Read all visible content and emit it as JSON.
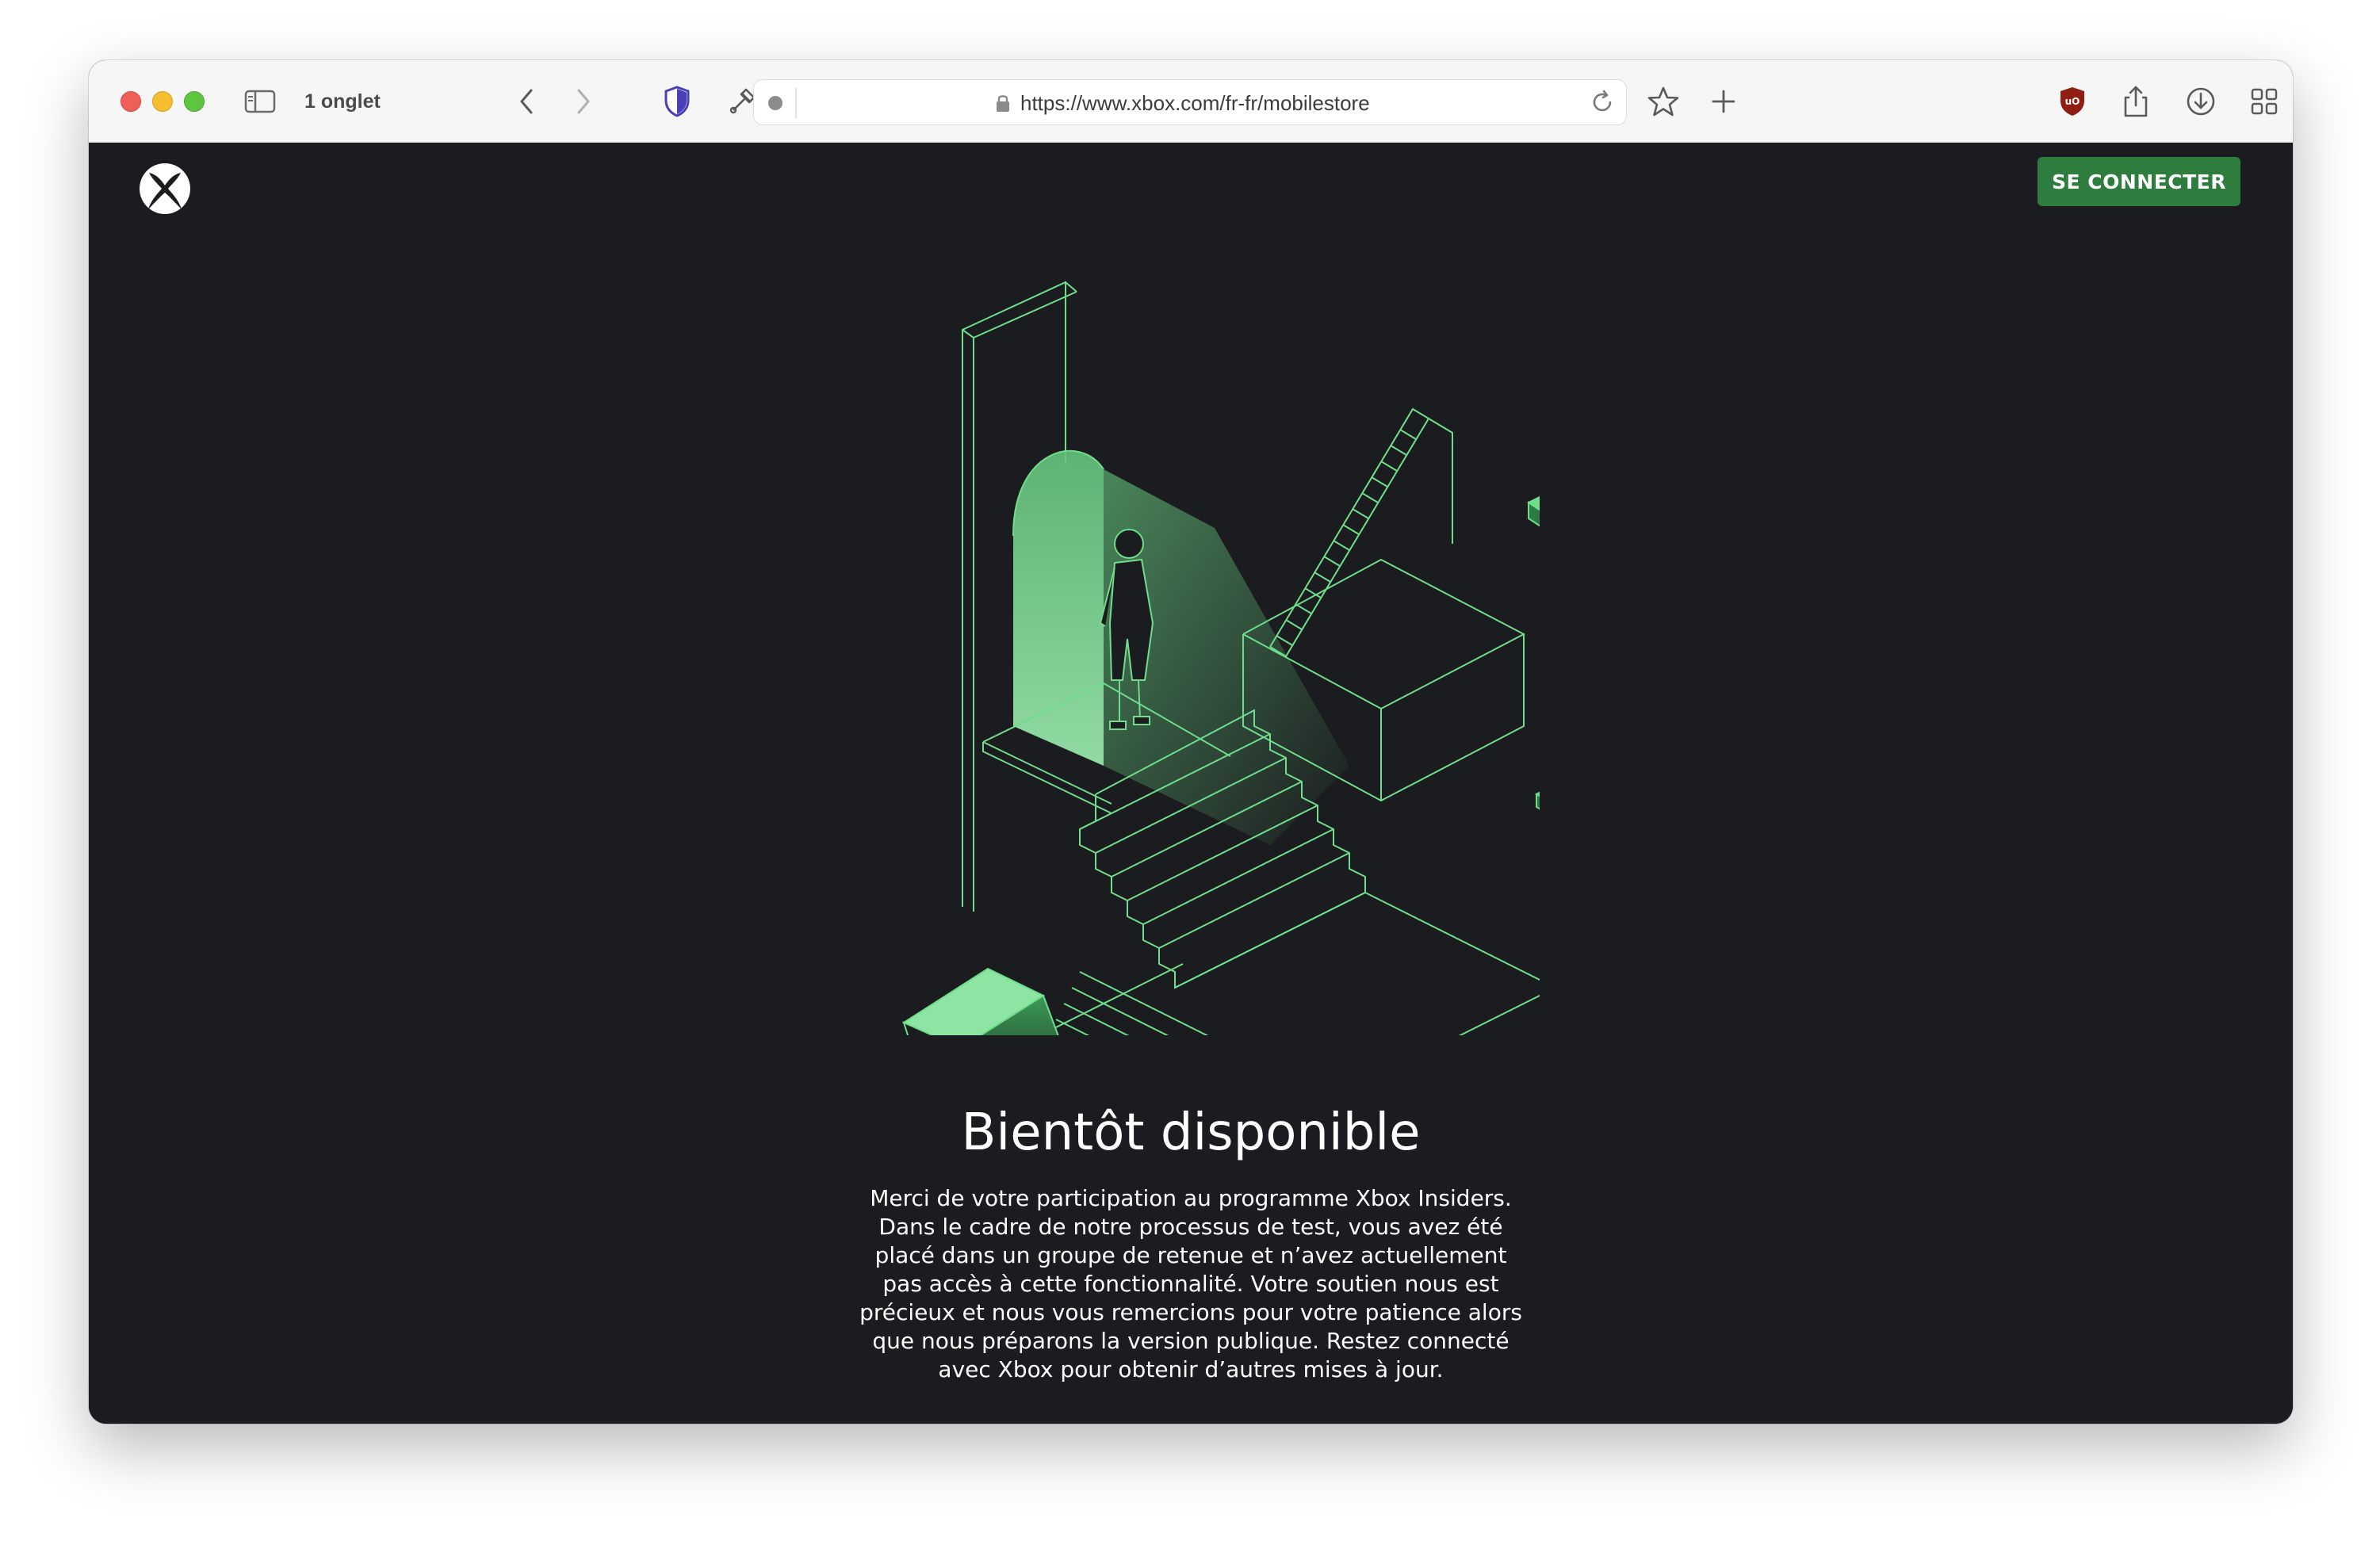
{
  "browser": {
    "tab_count_label": "1 onglet",
    "url": "https://www.xbox.com/fr-fr/mobilestore"
  },
  "header": {
    "logo_icon": "xbox-logo-icon",
    "signin_label": "SE CONNECTER"
  },
  "main": {
    "title": "Bientôt disponible",
    "message": "Merci de votre participation au programme Xbox Insiders. Dans le cadre de notre processus de test, vous avez été placé dans un groupe de retenue et n’avez actuellement pas accès à cette fonctionnalité. Votre soutien nous est précieux et nous vous remercions pour votre patience alors que nous préparons la version publique. Restez connecté avec Xbox pour obtenir d’autres mises à jour."
  },
  "colors": {
    "page_background": "#1b1c1f",
    "accent_green": "#2f7d3e",
    "line_green": "#6fdd8b",
    "text": "#ffffff"
  }
}
